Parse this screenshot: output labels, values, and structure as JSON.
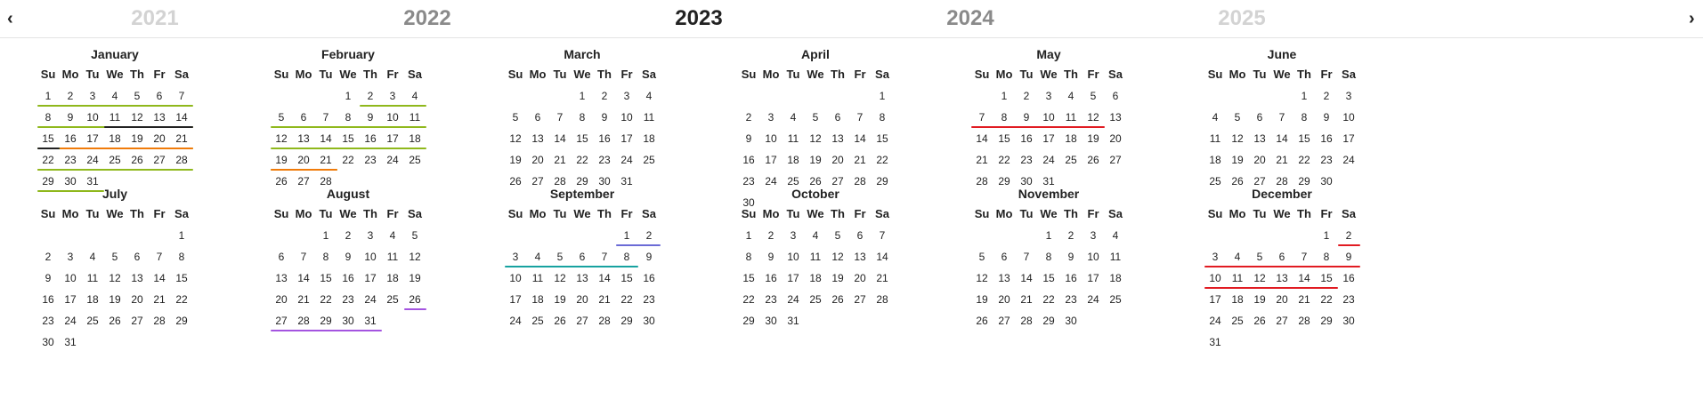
{
  "nav": {
    "prev_label": "‹",
    "next_label": "›"
  },
  "years": [
    {
      "label": "2021",
      "color": "#d3d3d3"
    },
    {
      "label": "2022",
      "color": "#8a8a8a"
    },
    {
      "label": "2023",
      "color": "#222222"
    },
    {
      "label": "2024",
      "color": "#8a8a8a"
    },
    {
      "label": "2025",
      "color": "#d3d3d3"
    }
  ],
  "weekday_labels": [
    "Su",
    "Mo",
    "Tu",
    "We",
    "Th",
    "Fr",
    "Sa"
  ],
  "months": [
    {
      "name": "January",
      "offset": 0,
      "days": 31
    },
    {
      "name": "February",
      "offset": 3,
      "days": 28
    },
    {
      "name": "March",
      "offset": 3,
      "days": 31
    },
    {
      "name": "April",
      "offset": 6,
      "days": 30
    },
    {
      "name": "May",
      "offset": 1,
      "days": 31
    },
    {
      "name": "June",
      "offset": 4,
      "days": 30
    },
    {
      "name": "July",
      "offset": 6,
      "days": 31
    },
    {
      "name": "August",
      "offset": 2,
      "days": 31
    },
    {
      "name": "September",
      "offset": 5,
      "days": 30
    },
    {
      "name": "October",
      "offset": 0,
      "days": 31
    },
    {
      "name": "November",
      "offset": 3,
      "days": 30
    },
    {
      "name": "December",
      "offset": 5,
      "days": 31
    }
  ],
  "events": [
    {
      "color": "#8fb81c",
      "ranges": [
        {
          "month": "January",
          "start": 1,
          "end": 21
        }
      ]
    },
    {
      "color": "#222222",
      "ranges": [
        {
          "month": "January",
          "start": 11,
          "end": 15
        }
      ]
    },
    {
      "color": "#f07b0a",
      "ranges": [
        {
          "month": "January",
          "start": 16,
          "end": 22
        }
      ]
    },
    {
      "color": "#8fb81c",
      "ranges": [
        {
          "month": "January",
          "start": 22,
          "end": 31
        },
        {
          "month": "February",
          "start": 2,
          "end": 21
        }
      ]
    },
    {
      "color": "#f07b0a",
      "ranges": [
        {
          "month": "February",
          "start": 19,
          "end": 21
        }
      ]
    },
    {
      "color": "#e11b22",
      "ranges": [
        {
          "month": "May",
          "start": 7,
          "end": 12
        }
      ]
    },
    {
      "color": "#a454e0",
      "ranges": [
        {
          "month": "August",
          "start": 26,
          "end": 31
        }
      ]
    },
    {
      "color": "#6b6bd6",
      "ranges": [
        {
          "month": "September",
          "start": 1,
          "end": 2
        }
      ]
    },
    {
      "color": "#17a2a0",
      "ranges": [
        {
          "month": "September",
          "start": 3,
          "end": 8
        }
      ]
    },
    {
      "color": "#e11b22",
      "ranges": [
        {
          "month": "December",
          "start": 2,
          "end": 15
        }
      ]
    }
  ]
}
